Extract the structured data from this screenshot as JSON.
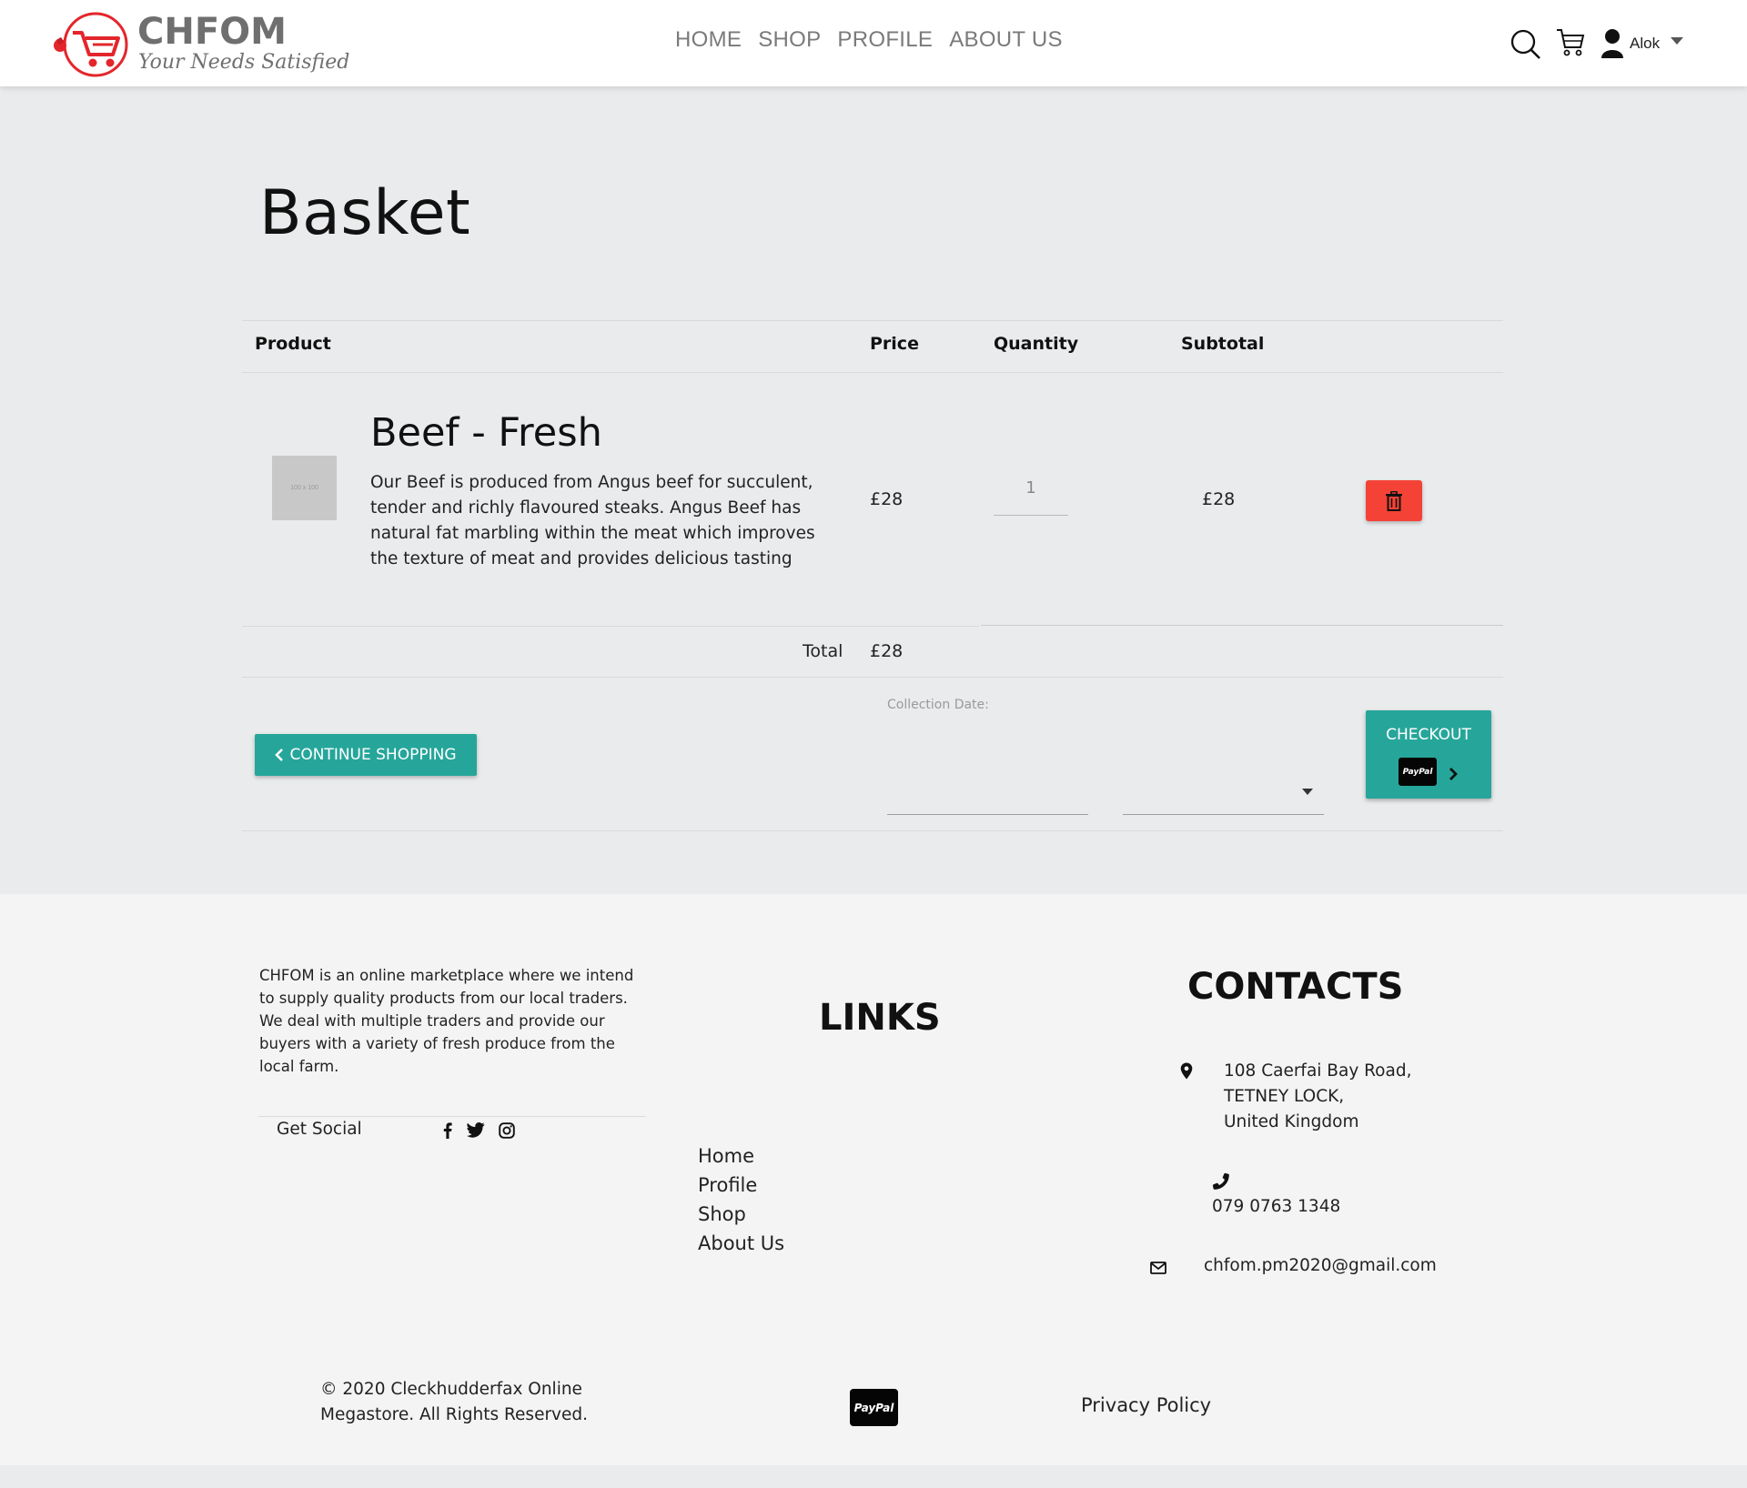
{
  "brand": {
    "name": "CHFOM",
    "tagline": "Your Needs Satisfied",
    "accent_red": "#e3262b",
    "teal": "#26a69a"
  },
  "nav": {
    "links": [
      "HOME",
      "SHOP",
      "PROFILE",
      "ABOUT US"
    ],
    "icons": [
      "search-icon",
      "cart-icon",
      "user-icon",
      "caret-down-icon"
    ],
    "user_name": "Alok"
  },
  "basket": {
    "title": "Basket",
    "headers": {
      "product": "Product",
      "price": "Price",
      "quantity": "Quantity",
      "subtotal": "Subtotal"
    },
    "items": [
      {
        "thumb_text": "100 x 100",
        "name": "Beef - Fresh",
        "description": "Our Beef is produced from Angus beef for succulent, tender and richly flavoured steaks. Angus Beef has natural fat marbling within the meat which improves the texture of meat and provides delicious tasting",
        "price": "£28",
        "quantity": "1",
        "subtotal": "£28"
      }
    ],
    "total_label": "Total",
    "total_value": "£28",
    "continue_label": "CONTINUE SHOPPING",
    "collection_label": "Collection Date:",
    "checkout_label": "CHECKOUT",
    "paypal_text": "PayPal",
    "delete_color": "#f44336"
  },
  "footer": {
    "about": "CHFOM is an online marketplace where we intend to supply quality products from our local traders. We deal with multiple traders and provide our buyers with a variety of fresh produce from the local farm.",
    "get_social": "Get Social",
    "social_icons": [
      "facebook-icon",
      "twitter-icon",
      "instagram-icon"
    ],
    "links_title": "LINKS",
    "links": [
      "Home",
      "Profile",
      "Shop",
      "About Us"
    ],
    "contacts_title": "CONTACTS",
    "address_lines": [
      "108 Caerfai Bay Road,",
      "TETNEY LOCK,",
      "United Kingdom"
    ],
    "phone": "079 0763 1348",
    "email": "chfom.pm2020@gmail.com",
    "copyright_lines": [
      "© 2020 Cleckhudderfax Online",
      "Megastore. All Rights Reserved."
    ],
    "paypal_text": "PayPal",
    "privacy": "Privacy Policy"
  }
}
